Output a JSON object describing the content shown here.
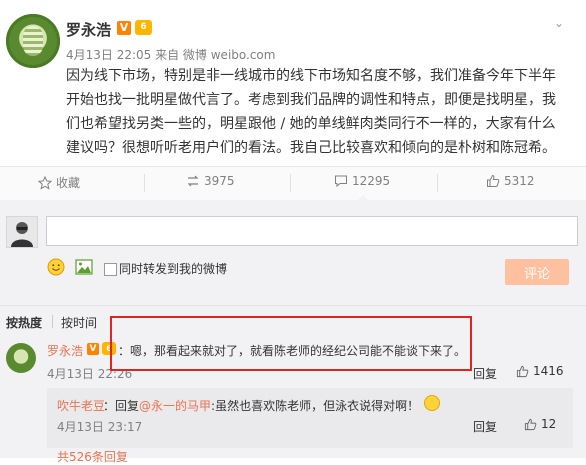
{
  "post": {
    "author": "罗永浩",
    "v_badge": "V",
    "vip_badge": "6",
    "meta": "4月13日 22:05 来自 微博 weibo.com",
    "lines": [
      "因为线下市场，特别是非一线城市的线下市场知名度不够，我们准备今年下半年",
      "开始也找一批明星做代言了。考虑到我们品牌的调性和特点，即便是找明星，我",
      "们也希望找另类一些的，明星跟他 / 她的单线鲜肉类同行不一样的，大家有什么",
      "建议吗？很想听听老用户们的看法。我自己比较喜欢和倾向的是朴树和陈冠希。"
    ]
  },
  "actions": {
    "favorite": "收藏",
    "repost_count": "3975",
    "comment_count": "12295",
    "like_count": "5312"
  },
  "compose": {
    "input_value": "",
    "repost_label": "同时转发到我的微博",
    "submit_label": "评论"
  },
  "sort": {
    "by_heat": "按热度",
    "by_time": "按时间"
  },
  "comment": {
    "author": "罗永浩",
    "v_badge": "V",
    "vip_badge": "6",
    "text": "：嗯，那看起来就对了，就看陈老师的经纪公司能不能谈下来了。",
    "time": "4月13日 22:26",
    "reply": "回复",
    "likes": "1416"
  },
  "subreply": {
    "author": "吹牛老豆",
    "text_prefix": "：回复",
    "mention": "@永一的马甲",
    "text_suffix": ":虽然也喜欢陈老师，但泳衣说得对啊！",
    "time": "4月13日 23:17",
    "reply": "回复",
    "likes": "12"
  },
  "more_replies": "共526条回复"
}
